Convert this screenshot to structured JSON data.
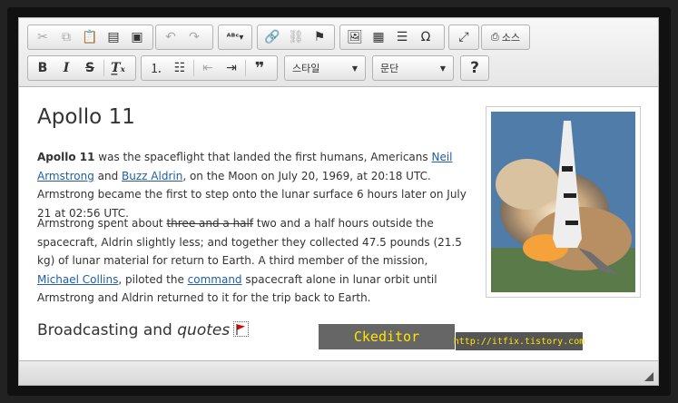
{
  "toolbar": {
    "source_label": "소스",
    "style_combo": "스타일",
    "format_combo": "문단",
    "help_label": "?",
    "bold_label": "B",
    "italic_label": "I",
    "strike_label": "S",
    "quote_label": "❞"
  },
  "content": {
    "title": "Apollo 11",
    "p1_bold": "Apollo 11",
    "p1_t1": " was the spaceflight that landed the first humans, Americans ",
    "p1_link1": "Neil Armstrong",
    "p1_t2": " and ",
    "p1_link2": "Buzz Aldrin",
    "p1_t3": ", on the Moon on July 20, 1969, at 20:18 UTC. Armstrong became the first to step onto the lunar surface 6 hours later on July 21 at 02:56 UTC.",
    "p2_t1": "Armstrong spent about ",
    "p2_strike": "three and a half",
    "p2_t2": " two and a half hours outside the spacecraft, Aldrin slightly less; and together they collected 47.5 pounds (21.5 kg) of lunar material for return to Earth. A third member of the mission, ",
    "p2_link1": "Michael Collins",
    "p2_t3": ", piloted the ",
    "p2_link2": "command",
    "p2_t4": " spacecraft alone in lunar orbit until Armstrong and Aldrin returned to it for the trip back to Earth.",
    "sub_t1": "Broadcasting and ",
    "sub_em": "quotes"
  },
  "overlay": {
    "badge1": "Ckeditor",
    "badge2": "http://itfix.tistory.com"
  },
  "colors": {
    "link": "#1f5ea8",
    "badge_text": "#ffe600"
  }
}
